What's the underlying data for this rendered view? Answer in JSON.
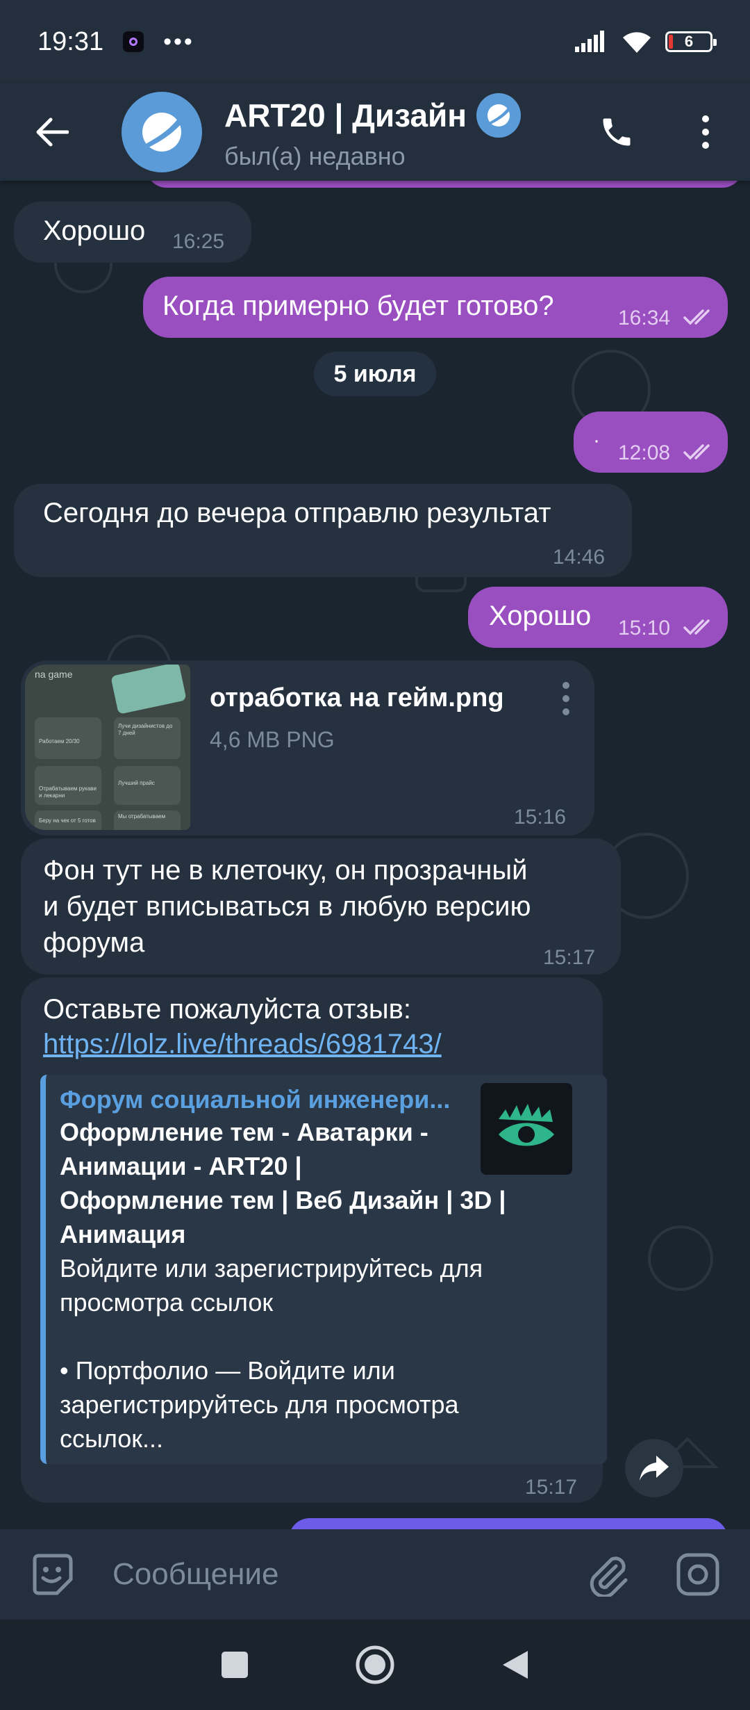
{
  "status_bar": {
    "time": "19:31",
    "dots": "•••",
    "battery": "6"
  },
  "header": {
    "title": "ART20 | Дизайн",
    "status": "был(а) недавно"
  },
  "messages": {
    "m1": {
      "text": "Хорошо",
      "time": "16:25"
    },
    "m2": {
      "text": "Когда примерно будет готово?",
      "time": "16:34"
    },
    "date": "5 июля",
    "m3": {
      "text": "·",
      "time": "12:08"
    },
    "m4": {
      "text": "Сегодня до вечера отправлю результат",
      "time": "14:46"
    },
    "m5": {
      "text": "Хорошо",
      "time": "15:10"
    },
    "file": {
      "name": "отработка на гейм.png",
      "meta": "4,6 MB PNG",
      "time": "15:16",
      "thumb_label": "na game",
      "thumb_cards": [
        "Работаем 20/30",
        "Лучи дизайнистов до 7 дней",
        "Отрабатываем рукави и лекарни",
        "Лучший прайс",
        "Беру на чек от 5 готов",
        "Мы отрабатываем"
      ]
    },
    "m6": {
      "line1": "Фон тут не в клеточку, он прозрачный",
      "line2": "и будет вписываться в любую версию",
      "line3": "форума",
      "time": "15:17"
    },
    "m7": {
      "text": "Оставьте пожалуйста отзыв:",
      "link": "https://lolz.live/threads/6981743/",
      "preview": {
        "site": "Форум социальной инженери...",
        "title1": "Оформление тем - Аватарки -",
        "title2": "Анимации - ART20 |",
        "title3": "Оформление тем | Веб Дизайн | 3D |",
        "title4": "Анимация",
        "desc1": "Войдите или зарегистрируйтесь для",
        "desc2": "просмотра ссылок",
        "desc3": "• Портфолио — Войдите или",
        "desc4": "зарегистрируйтесь для просмотра",
        "desc5": "ссылок..."
      },
      "time": "15:17"
    }
  },
  "input": {
    "placeholder": "Сообщение"
  },
  "colors": {
    "outgoing": "#9a4fc0",
    "incoming": "#26313f",
    "accent": "#5b9bd8",
    "link": "#6fb3f2"
  },
  "icons": [
    "back-arrow-icon",
    "phone-icon",
    "more-vert-icon",
    "emoji-icon",
    "attach-icon",
    "camera-icon",
    "forward-icon",
    "verified-icon",
    "double-check-icon"
  ]
}
